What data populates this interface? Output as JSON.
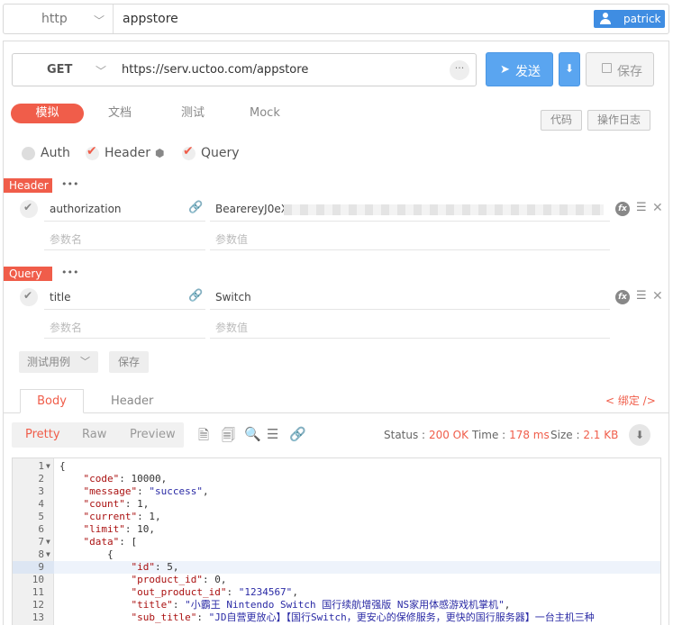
{
  "topbar": {
    "protocol": "http",
    "project": "appstore",
    "user": "patrick"
  },
  "request": {
    "method": "GET",
    "url": "https://serv.uctoo.com/appstore",
    "send_label": "发送",
    "save_label": "保存"
  },
  "mode_tabs": [
    "模拟",
    "文档",
    "测试",
    "Mock"
  ],
  "right_buttons": {
    "code": "代码",
    "log": "操作日志"
  },
  "options": {
    "auth": "Auth",
    "header": "Header",
    "query": "Query"
  },
  "header_section": {
    "tag": "Header",
    "rows": [
      {
        "name": "authorization",
        "value": "BearereyJ0eX"
      }
    ],
    "name_placeholder": "参数名",
    "value_placeholder": "参数值"
  },
  "query_section": {
    "tag": "Query",
    "rows": [
      {
        "name": "title",
        "value": "Switch"
      }
    ],
    "name_placeholder": "参数名",
    "value_placeholder": "参数值"
  },
  "testcase_label": "测试用例",
  "testcase_save": "保存",
  "response": {
    "tabs": [
      "Body",
      "Header"
    ],
    "bind": "< 绑定 />",
    "view_tabs": [
      "Pretty",
      "Raw",
      "Preview"
    ],
    "status_label": "Status :",
    "status_value": "200 OK",
    "time_label": "Time :",
    "time_value": "178 ms",
    "size_label": "Size :",
    "size_value": "2.1 KB"
  },
  "code_lines": [
    {
      "n": "1",
      "fold": true,
      "text": "{"
    },
    {
      "n": "2",
      "fold": false,
      "text": "    \"code\": 10000,"
    },
    {
      "n": "3",
      "fold": false,
      "text": "    \"message\": \"success\","
    },
    {
      "n": "4",
      "fold": false,
      "text": "    \"count\": 1,"
    },
    {
      "n": "5",
      "fold": false,
      "text": "    \"current\": 1,"
    },
    {
      "n": "6",
      "fold": false,
      "text": "    \"limit\": 10,"
    },
    {
      "n": "7",
      "fold": true,
      "text": "    \"data\": ["
    },
    {
      "n": "8",
      "fold": true,
      "text": "        {"
    },
    {
      "n": "9",
      "fold": false,
      "text": "            \"id\": 5,",
      "hl": true
    },
    {
      "n": "10",
      "fold": false,
      "text": "            \"product_id\": 0,"
    },
    {
      "n": "11",
      "fold": false,
      "text": "            \"out_product_id\": \"1234567\","
    },
    {
      "n": "12",
      "fold": false,
      "text": "            \"title\": \"小霸王 Nintendo Switch 国行续航增强版 NS家用体感游戏机掌机\","
    },
    {
      "n": "13",
      "fold": false,
      "text": "            \"sub_title\": \"JD自营更放心】【国行Switch，更安心的保修服务，更快的国行服务器】一台主机三种"
    }
  ]
}
